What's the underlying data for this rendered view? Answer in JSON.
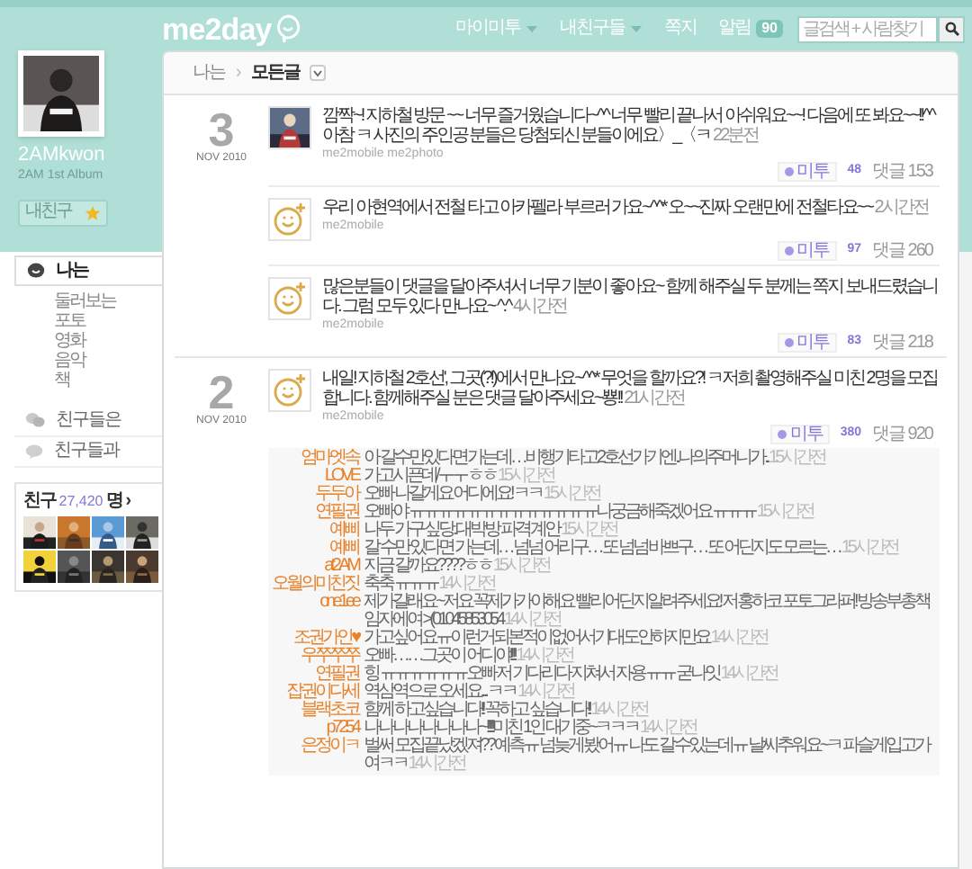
{
  "header": {
    "logo": "me2day",
    "nav": [
      {
        "label": "마이미투",
        "dropdown": true
      },
      {
        "label": "내친구들",
        "dropdown": true
      },
      {
        "label": "쪽지",
        "dropdown": false
      },
      {
        "label": "알림",
        "dropdown": false,
        "badge": "90"
      }
    ],
    "search": {
      "placeholder": "글검색 + 사람찾기"
    }
  },
  "profile": {
    "name": "2AMkwon",
    "subtitle": "2AM 1st Album",
    "friend_button": "내친구"
  },
  "sidebar": {
    "items": [
      {
        "label": "나는",
        "selected": true,
        "children": [
          {
            "label": "둘러보는"
          },
          {
            "label": "포토"
          },
          {
            "label": "영화"
          },
          {
            "label": "음악"
          },
          {
            "label": "책"
          }
        ]
      },
      {
        "label": "친구들은",
        "selected": false
      },
      {
        "label": "친구들과",
        "selected": false
      }
    ],
    "friends": {
      "label": "친구",
      "count": "27,420",
      "unit": "명",
      "arrow": "›"
    }
  },
  "breadcrumb": {
    "parent": "나는",
    "separator": "›",
    "current": "모든글"
  },
  "days": [
    {
      "day": "3",
      "month_year": "NOV 2010",
      "posts": [
        {
          "text": "깜짝~! 지하철 방문 ~~ 너무 즐거웠습니다~^^ 너무 빨리 끝나서 아쉬워요~~! 다음에 또 봐요~~!!^^ 아참 ㅋ 사진의 주인공 분들은 당첨되신 분들이에요〉_〈ㅋ",
          "time": "22분전",
          "source": "me2mobile me2photo",
          "metoo": "미투",
          "metoo_count": "48",
          "comments": "댓글 153"
        },
        {
          "kind": "smiley",
          "text": "우리 아현역에서 전철 타고 아카펠라 부르러 가요~^^* 오~~진짜 오랜만에 전철타요~~",
          "time": "2시간전",
          "source": "me2mobile",
          "metoo": "미투",
          "metoo_count": "97",
          "comments": "댓글 260"
        },
        {
          "kind": "smiley",
          "text": "많은분들이 댓글을 달아주셔서 너무 기분이 좋아요~ 함께 해주실 두 분께는 쪽지 보내드렸습니다. 그럼 모두 있다 만나요~ ^.^",
          "time": "4시간전",
          "source": "me2mobile",
          "metoo": "미투",
          "metoo_count": "83",
          "comments": "댓글 218"
        }
      ]
    },
    {
      "day": "2",
      "month_year": "NOV 2010",
      "posts": [
        {
          "kind": "smiley",
          "text": "내일! 지하철 2호선', 그곳(?!)에서 만나요~^^* 무엇을 할까요?! ㅋ저희 촬영해주실 미친 2명을 모집합니다. 함께해주실 분은 댓글 달아주세요~뿅!!",
          "time": "21시간전",
          "source": "me2mobile",
          "metoo": "미투",
          "metoo_count": "380",
          "comments": "댓글 920",
          "replies": [
            {
              "name": "엄마엣속",
              "text": "아 갈수만있다면 가는데…비행기타고2호선가기엔..나의주머니가..",
              "time": "15시간전"
            },
            {
              "name": "LOVE",
              "text": "가고시픈데/ㅜㅜ ㅎㅎ",
              "time": "15시간전"
            },
            {
              "name": "두두아",
              "text": "오빠 나갈게요 어디에요! ㅋㅋ",
              "time": "15시간전"
            },
            {
              "name": "연필권",
              "text": "오빠야 ㅠㅠㅠㅠㅠㅠㅠㅠㅠㅠㅠㅠㅠ나궁금해죽겠어요 ㅠㅠㅠ",
              "time": "15시간전"
            },
            {
              "name": "예삐",
              "text": "나두 가구 싶당..대박방 파격 계안",
              "time": "15시간전"
            },
            {
              "name": "예삐",
              "text": "갈 수만 있다면 가는데… 넘넘 어리구… 또 넘넘 바쁘구… 또 어딘지도 모르는…",
              "time": "15시간전"
            },
            {
              "name": "at2AM",
              "text": "지금 갈까요????ㅎㅎ",
              "time": "15시간전"
            },
            {
              "name": "오월의미친짓",
              "text": "축축 ㅠㅠㅠ",
              "time": "14시간전"
            },
            {
              "name": "one1ee",
              "text": "제가갈래요~저요 꼭제가가야해요 빨리어딘지알려주세요! 저 홍하코 포토그라퍼! 방송부총책임자에여 >(01045853054",
              "time": "14시간전"
            },
            {
              "name": "조권가인♥",
              "text": "가고싶어요ㅠ이런거되본적이없어서기대도안하지만요",
              "time": "14시간전"
            },
            {
              "name": "우쭈쭈쭈",
              "text": "오빠……그곳이 어디야!!!!",
              "time": "14시간전"
            },
            {
              "name": "연필권",
              "text": "힝 ㅠㅠㅠㅠㅠㅠ오빠 저 기다리다 지쳐서 자용 ㅠㅠ 굳나잇",
              "time": "14시간전"
            },
            {
              "name": "잡권이다세",
              "text": "역삼역으로 오세요.... ㅋㅋ",
              "time": "14시간전"
            },
            {
              "name": "블랙초코",
              "text": "함께 하고싶습니다!! 꼭하고 싶습니다!!",
              "time": "14시간전"
            },
            {
              "name": "p7254",
              "text": "나나나나나나나나~!!!!!미친 1인 대기중~ㅋㅋㅋ",
              "time": "14시간전"
            },
            {
              "name": "은정이ㅋ",
              "text": "벌써 모집끝났겠져?? 예측ㅠ 넘늦게 봤어ㅠ 나도 갈 수있는데ㅠ 날씨추워요~ㅋ 파슬게입고가여ㅋㅋ",
              "time": "14시간전"
            }
          ]
        }
      ]
    }
  ]
}
